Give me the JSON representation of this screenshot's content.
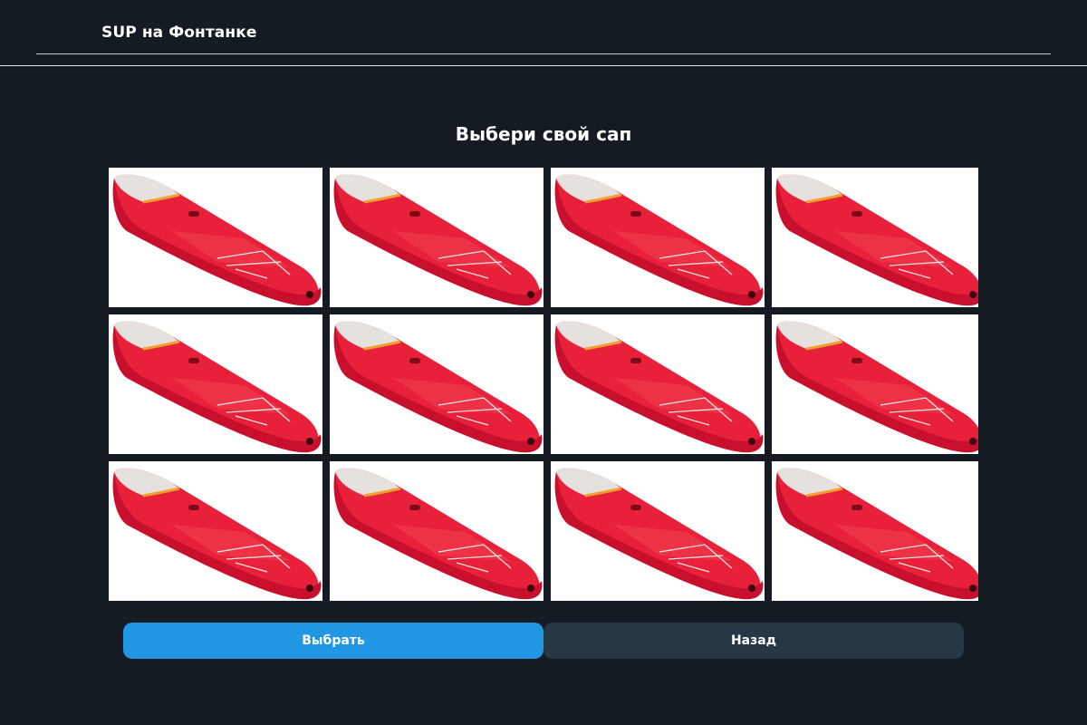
{
  "header": {
    "brand": "SUP на Фонтанке"
  },
  "main": {
    "title": "Выбери свой сап",
    "boards": [
      {
        "selected": false
      },
      {
        "selected": false
      },
      {
        "selected": false
      },
      {
        "selected": false
      },
      {
        "selected": false
      },
      {
        "selected": false
      },
      {
        "selected": false
      },
      {
        "selected": false
      },
      {
        "selected": false
      },
      {
        "selected": false
      },
      {
        "selected": false
      },
      {
        "selected": false
      }
    ],
    "board_colors": {
      "hull": "#e8203a",
      "hull_dark": "#c8102e",
      "deck_pad": "#f0404f",
      "nose": "#e6e1dc",
      "accent": "#f0a030"
    }
  },
  "actions": {
    "select_label": "Выбрать",
    "back_label": "Назад"
  },
  "colors": {
    "background": "#141b22",
    "primary": "#2196e3",
    "secondary": "#263746"
  }
}
